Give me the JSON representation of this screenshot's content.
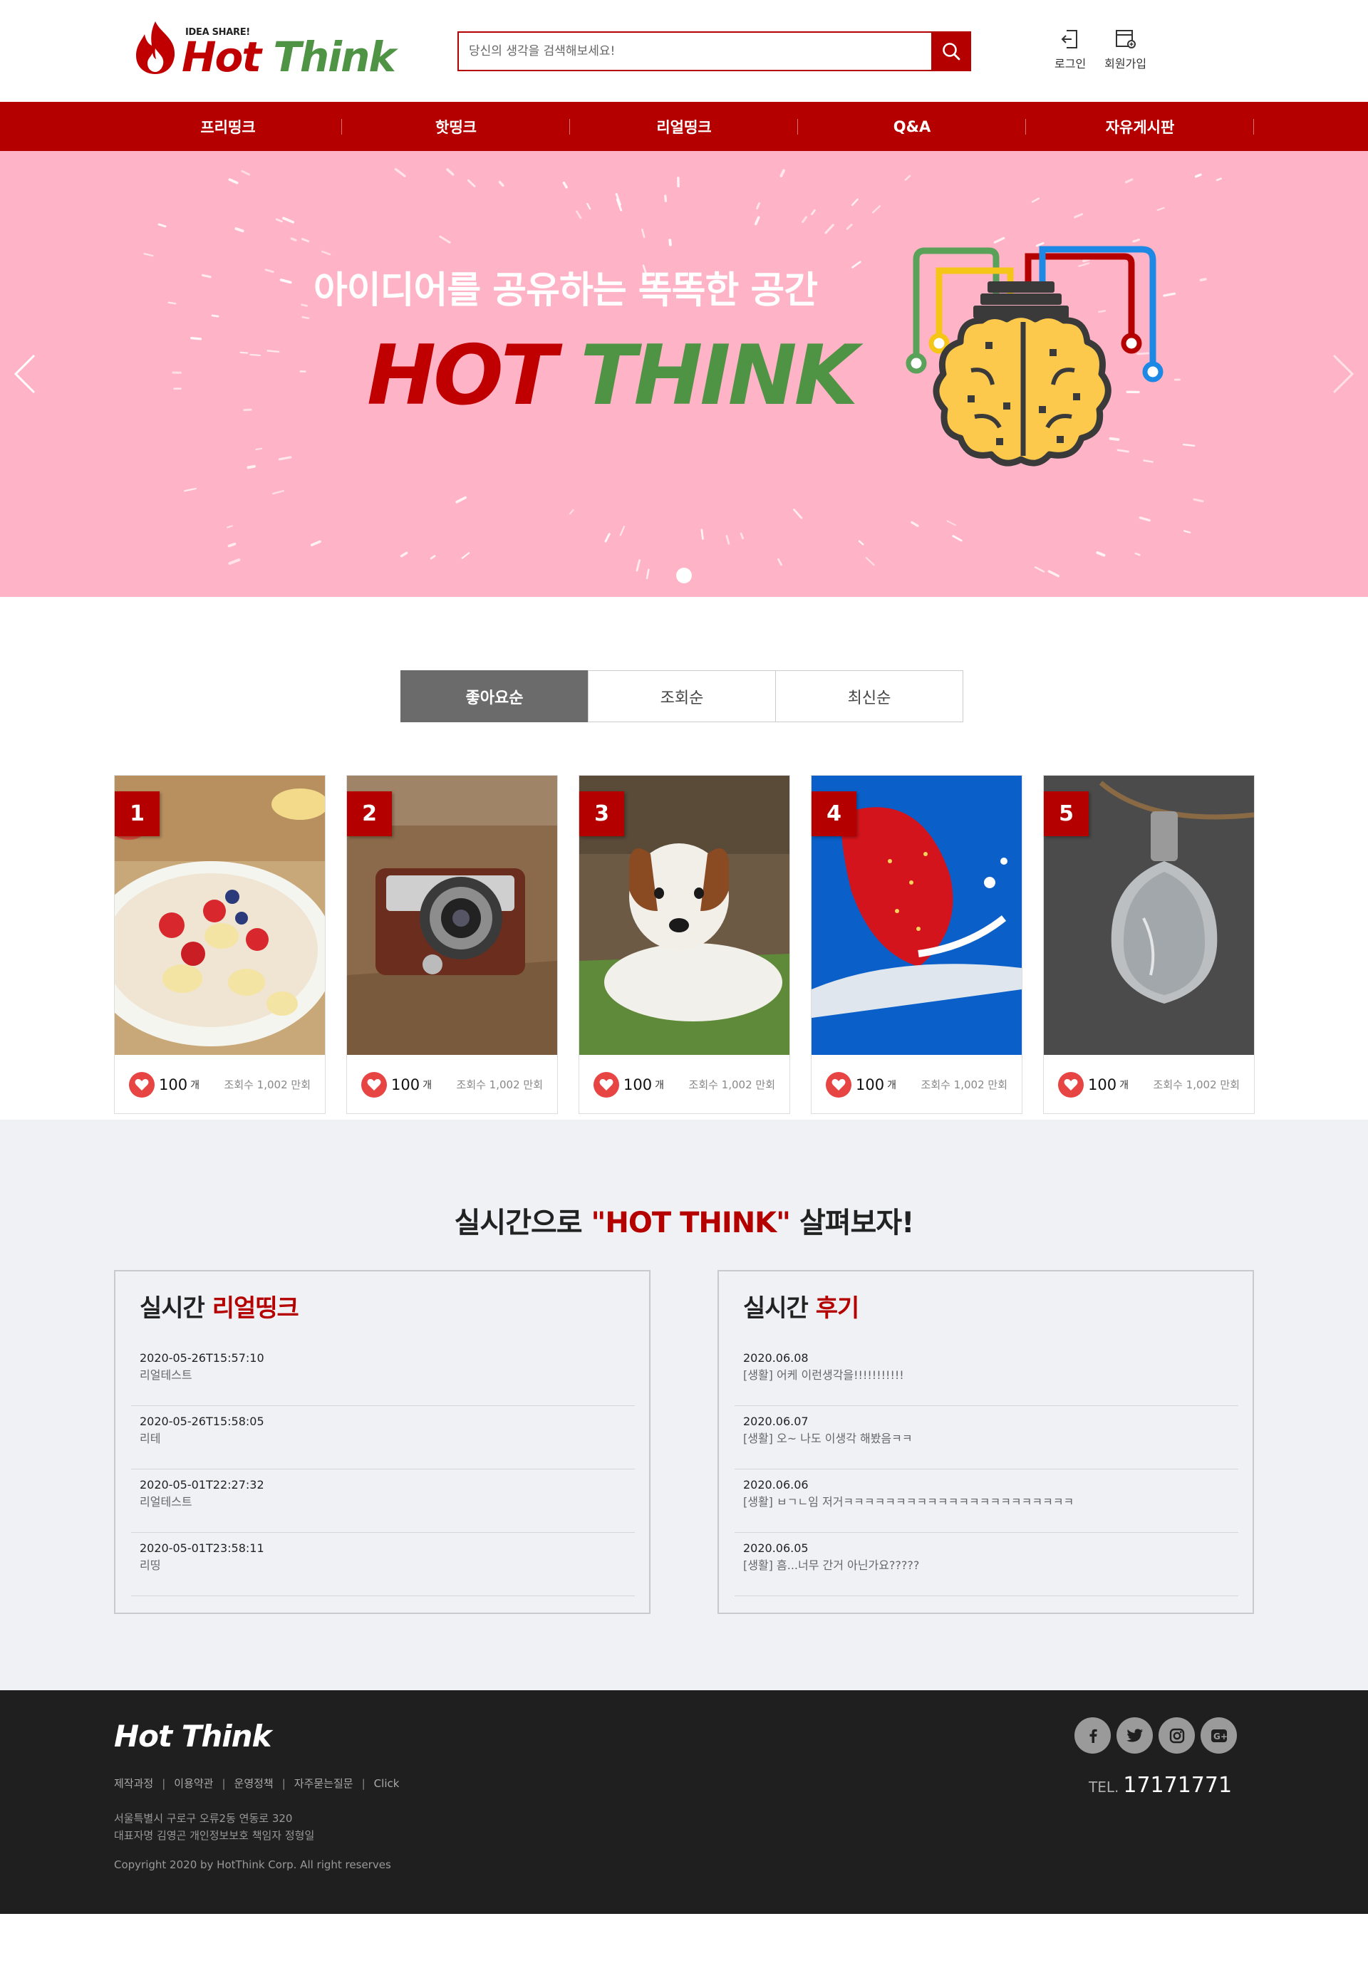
{
  "header": {
    "logo_tag": "IDEA SHARE!",
    "logo_hot": "Hot",
    "logo_think": "Think",
    "search_placeholder": "당신의 생각을 검색해보세요!",
    "login_label": "로그인",
    "signup_label": "회원가입"
  },
  "nav": {
    "items": [
      "프리띵크",
      "핫띵크",
      "리얼띵크",
      "Q&A",
      "자유게시판"
    ]
  },
  "hero": {
    "subtitle": "아이디어를 공유하는 똑똑한 공간",
    "title_hot": "HOT",
    "title_think": "THINK",
    "background_color": "#ffb3c6",
    "slides_count": 1
  },
  "sort_tabs": {
    "items": [
      "좋아요순",
      "조회순",
      "최신순"
    ],
    "active_index": 0
  },
  "cards": [
    {
      "rank": "1",
      "image": "fruit-cereal-bowl",
      "likes": "100",
      "unit": "개",
      "views": "조회수 1,002 만회"
    },
    {
      "rank": "2",
      "image": "vintage-camera",
      "likes": "100",
      "unit": "개",
      "views": "조회수 1,002 만회"
    },
    {
      "rank": "3",
      "image": "puppy-on-grass",
      "likes": "100",
      "unit": "개",
      "views": "조회수 1,002 만회"
    },
    {
      "rank": "4",
      "image": "strawberry-milk-splash",
      "likes": "100",
      "unit": "개",
      "views": "조회수 1,002 만회"
    },
    {
      "rank": "5",
      "image": "hanging-light-bulb",
      "likes": "100",
      "unit": "개",
      "views": "조회수 1,002 만회"
    }
  ],
  "realtime": {
    "heading_pre": "실시간으로 ",
    "heading_accent": "\"HOT THINK\"",
    "heading_post": " 살펴보자!",
    "left_panel": {
      "title_pre": "실시간 ",
      "title_accent": "리얼띵크",
      "items": [
        {
          "date": "2020-05-26T15:57:10",
          "text": "리얼테스트"
        },
        {
          "date": "2020-05-26T15:58:05",
          "text": "리테"
        },
        {
          "date": "2020-05-01T22:27:32",
          "text": "리얼테스트"
        },
        {
          "date": "2020-05-01T23:58:11",
          "text": "리띵"
        }
      ]
    },
    "right_panel": {
      "title_pre": "실시간 ",
      "title_accent": "후기",
      "items": [
        {
          "date": "2020.06.08",
          "text": "[생활] 어케 이런생각을!!!!!!!!!!!"
        },
        {
          "date": "2020.06.07",
          "text": "[생활] 오~ 나도 이생각 해봤음ㅋㅋ"
        },
        {
          "date": "2020.06.06",
          "text": "[생활] ㅂㄱㄴ임 저거ㅋㅋㅋㅋㅋㅋㅋㅋㅋㅋㅋㅋㅋㅋㅋㅋㅋㅋㅋㅋㅋㅋ"
        },
        {
          "date": "2020.06.05",
          "text": "[생활] 흠...너무 간거 아닌가요?????"
        }
      ]
    }
  },
  "footer": {
    "logo": "Hot Think",
    "links": [
      "제작과정",
      "이용약관",
      "운영정책",
      "자주묻는질문",
      "Click"
    ],
    "address_line1": "서울특별시 구로구 오류2동 연동로 320",
    "address_line2": "대표자명 김영곤 개인정보보호 책임자 정형일",
    "copyright": "Copyright 2020 by HotThink Corp. All right reserves",
    "tel_label": "TEL.",
    "tel_number": "17171771",
    "social": [
      "facebook-icon",
      "twitter-icon",
      "instagram-icon",
      "google-plus-icon"
    ]
  },
  "colors": {
    "brand_red": "#b50000",
    "brand_green": "#4f9444",
    "hero_pink": "#ffb3c6",
    "footer_bg": "#1f1f20"
  }
}
